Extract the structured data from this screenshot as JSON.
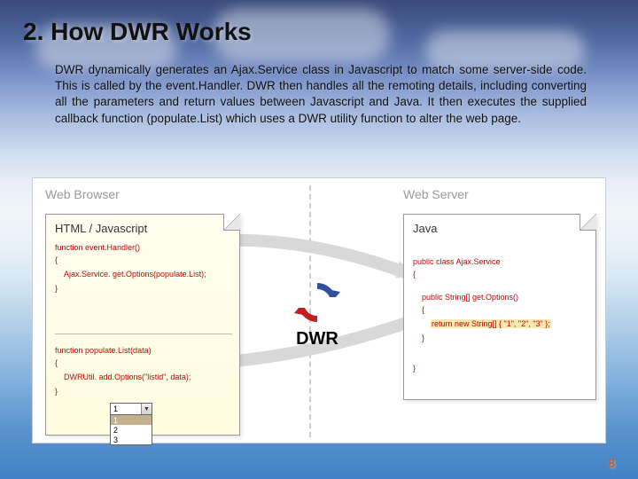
{
  "title": "2. How DWR Works",
  "body": "DWR dynamically generates an Ajax.Service class in Javascript to match some server-side code. This is called by the event.Handler. DWR then handles all the remoting details, including converting all the parameters and return values between Javascript and Java. It then executes the supplied callback function (populate.List) which uses a DWR utility function to alter the web page.",
  "panels": {
    "left": "Web Browser",
    "right": "Web Server"
  },
  "left_page": {
    "title": "HTML / Javascript",
    "fn1_sig": "function event.Handler()",
    "fn1_body": "Ajax.Service. get.Options(populate.List);",
    "fn2_sig": "function populate.List(data)",
    "fn2_body": "DWRUtil. add.Options(\"listid\", data);",
    "brace_o": "{",
    "brace_c": "}"
  },
  "right_page": {
    "title": "Java",
    "cls": "public class Ajax.Service",
    "meth": "public String[] get.Options()",
    "ret": "return new String[] { \"1\", \"2\", \"3\" };",
    "brace_o": "{",
    "brace_c": "}"
  },
  "dropdown": {
    "selected": "1",
    "options": [
      "1",
      "2",
      "3"
    ]
  },
  "logo": "DWR",
  "page_number": "8"
}
